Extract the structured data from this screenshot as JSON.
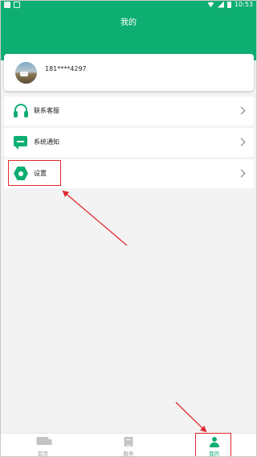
{
  "status_bar": {
    "time": "10:53"
  },
  "header": {
    "title": "我的"
  },
  "profile": {
    "phone": "181****4297"
  },
  "menu": [
    {
      "label": "联系客服",
      "icon": "headset-icon"
    },
    {
      "label": "系统通知",
      "icon": "message-icon"
    },
    {
      "label": "设置",
      "icon": "settings-icon"
    }
  ],
  "bottom_nav": [
    {
      "label": "首页",
      "icon": "truck-icon",
      "active": false
    },
    {
      "label": "服务",
      "icon": "document-icon",
      "active": false
    },
    {
      "label": "我的",
      "icon": "person-icon",
      "active": true
    }
  ],
  "colors": {
    "brand": "#0eae72",
    "annotation": "#e0282e",
    "background": "#f3f3f3"
  }
}
